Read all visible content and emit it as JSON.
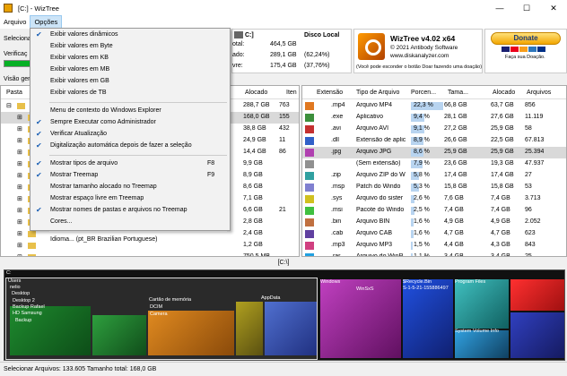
{
  "window": {
    "title": "[C:] - WizTree",
    "minimize": "—",
    "maximize": "☐",
    "close": "✕"
  },
  "menubar": {
    "items": [
      "Arquivo",
      "Opções"
    ]
  },
  "toppanel": {
    "select_label": "Seleciona",
    "verify_label": "Verificaç",
    "view_label": "Visão ger",
    "drive": "C:]",
    "drive_name": "Disco Local",
    "total_label": "otal:",
    "total_value": "464,5 GB",
    "used_label": "ado:",
    "used_value": "289,1 GB",
    "used_pct": "(62,24%)",
    "free_label": "vre:",
    "free_value": "175,4 GB",
    "free_pct": "(37,76%)"
  },
  "logo": {
    "title": "WizTree v4.02 x64",
    "copyright": "© 2021 Antibody Software",
    "url": "www.diskanalyzer.com",
    "note": "(Você pode esconder o botão Doar fazendo uma doação)"
  },
  "donate": {
    "button": "Donate",
    "thanks": "Faça sua Doação.",
    "cards_colors": [
      "#1a1f71",
      "#eb001b",
      "#f79e1b",
      "#2e77bc",
      "#003087"
    ]
  },
  "left": {
    "headers": [
      "Pasta",
      "Alocado",
      "Iten"
    ],
    "rows": [
      {
        "alloc": "288,7 GB",
        "items": "763"
      },
      {
        "alloc": "168,0 GB",
        "items": "155"
      },
      {
        "alloc": "38,8 GB",
        "items": "432"
      },
      {
        "alloc": "24,9 GB",
        "items": "11"
      },
      {
        "alloc": "14,4 GB",
        "items": "86"
      },
      {
        "alloc": "9,9 GB",
        "items": ""
      },
      {
        "alloc": "8,9 GB",
        "items": ""
      },
      {
        "alloc": "8,6 GB",
        "items": ""
      },
      {
        "alloc": "7,1 GB",
        "items": ""
      },
      {
        "alloc": "6,6 GB",
        "items": "21"
      },
      {
        "alloc": "2,8 GB",
        "items": ""
      },
      {
        "alloc": "2,4 GB",
        "items": ""
      },
      {
        "alloc": "1,2 GB",
        "items": ""
      },
      {
        "alloc": "750,5 MB",
        "items": ""
      }
    ]
  },
  "right": {
    "headers": [
      "Extensão",
      "Tipo de Arquivo",
      "Porcen...",
      "Tama...",
      "Alocado",
      "Arquivos"
    ],
    "rows": [
      {
        "ext": ".mp4",
        "type": "Arquivo MP4",
        "pct": "22,3 %",
        "size": "66,8 GB",
        "alloc": "63,7 GB",
        "files": "856",
        "color": "#e07820",
        "bar": 0.223
      },
      {
        "ext": ".exe",
        "type": "Aplicativo",
        "pct": "9,4 %",
        "size": "28,1 GB",
        "alloc": "27,6 GB",
        "files": "11.119",
        "color": "#3c8f3c",
        "bar": 0.094
      },
      {
        "ext": ".avi",
        "type": "Arquivo AVI",
        "pct": "9,1 %",
        "size": "27,2 GB",
        "alloc": "25,9 GB",
        "files": "58",
        "color": "#c43030",
        "bar": 0.091
      },
      {
        "ext": ".dll",
        "type": "Extensão de aplic",
        "pct": "8,9 %",
        "size": "26,6 GB",
        "alloc": "22,5 GB",
        "files": "67.813",
        "color": "#3060c8",
        "bar": 0.089
      },
      {
        "ext": ".jpg",
        "type": "Arquivo JPG",
        "pct": "8,6 %",
        "size": "25,9 GB",
        "alloc": "25,9 GB",
        "files": "25.394",
        "color": "#b040b0",
        "bar": 0.086
      },
      {
        "ext": "",
        "type": "(Sem extensão)",
        "pct": "7,9 %",
        "size": "23,6 GB",
        "alloc": "19,3 GB",
        "files": "47.937",
        "color": "#909090",
        "bar": 0.079
      },
      {
        "ext": ".zip",
        "type": "Arquivo ZIP do W",
        "pct": "5,8 %",
        "size": "17,4 GB",
        "alloc": "17,4 GB",
        "files": "27",
        "color": "#30a0a0",
        "bar": 0.058
      },
      {
        "ext": ".msp",
        "type": "Patch do Windo",
        "pct": "5,3 %",
        "size": "15,8 GB",
        "alloc": "15,8 GB",
        "files": "53",
        "color": "#8080d0",
        "bar": 0.053
      },
      {
        "ext": ".sys",
        "type": "Arquivo do sister",
        "pct": "2,6 %",
        "size": "7,6 GB",
        "alloc": "7,4 GB",
        "files": "3.713",
        "color": "#d0c020",
        "bar": 0.026
      },
      {
        "ext": ".msi",
        "type": "Pacote do Windo",
        "pct": "2,5 %",
        "size": "7,4 GB",
        "alloc": "7,4 GB",
        "files": "96",
        "color": "#40c040",
        "bar": 0.025
      },
      {
        "ext": ".bin",
        "type": "Arquivo BIN",
        "pct": "1,6 %",
        "size": "4,9 GB",
        "alloc": "4,9 GB",
        "files": "2.052",
        "color": "#c07040",
        "bar": 0.016
      },
      {
        "ext": ".cab",
        "type": "Arquivo CAB",
        "pct": "1,6 %",
        "size": "4,7 GB",
        "alloc": "4,7 GB",
        "files": "623",
        "color": "#6040a0",
        "bar": 0.016
      },
      {
        "ext": ".mp3",
        "type": "Arquivo MP3",
        "pct": "1,5 %",
        "size": "4,4 GB",
        "alloc": "4,3 GB",
        "files": "843",
        "color": "#d04080",
        "bar": 0.015
      },
      {
        "ext": ".rar",
        "type": "Arquivo do WinR",
        "pct": "1,1 %",
        "size": "3,4 GB",
        "alloc": "3,4 GB",
        "files": "25",
        "color": "#20a0e0",
        "bar": 0.011
      }
    ]
  },
  "path": "[C:\\]",
  "treemap": {
    "labels": {
      "c": "C:",
      "users": "Users",
      "user": "nelio",
      "desktop": "Desktop",
      "desktop2": "Desktop 2",
      "backup_rafael": "Backup Rafael",
      "hd_samsung": "HD Samsung",
      "backup": "Backup",
      "cartao": "Cartão de memória",
      "dcim": "DCIM",
      "camera": "Camera",
      "appdata": "AppData",
      "windows": "Windows",
      "winsxs": "WinSxS",
      "recycle": "$Recycle.Bin",
      "sid": "S-1-5-21-155886497",
      "program_files": "Program Files",
      "system_volume": "System Volume Info"
    }
  },
  "status": "Selecionar Arquivos: 133.605  Tamanho total: 168,0 GB",
  "menu": {
    "items": [
      {
        "label": "Exibir valores dinâmicos",
        "checked": true,
        "shortcut": ""
      },
      {
        "label": "Exibir valores em Byte",
        "checked": false,
        "shortcut": ""
      },
      {
        "label": "Exibir valores em KB",
        "checked": false,
        "shortcut": ""
      },
      {
        "label": "Exibir valores em MB",
        "checked": false,
        "shortcut": ""
      },
      {
        "label": "Exibir valores em GB",
        "checked": false,
        "shortcut": ""
      },
      {
        "label": "Exibir valores de TB",
        "checked": false,
        "shortcut": ""
      },
      {
        "sep": true
      },
      {
        "label": "Menu de contexto do Windows Explorer",
        "checked": false,
        "shortcut": ""
      },
      {
        "label": "Sempre Executar como Administrador",
        "checked": true,
        "shortcut": ""
      },
      {
        "label": "Verificar Atualização",
        "checked": true,
        "shortcut": ""
      },
      {
        "label": "Digitalização automática depois de fazer a seleção",
        "checked": true,
        "shortcut": ""
      },
      {
        "sep": true
      },
      {
        "label": "Mostrar tipos de arquivo",
        "checked": true,
        "shortcut": "F8"
      },
      {
        "label": "Mostrar Treemap",
        "checked": true,
        "shortcut": "F9"
      },
      {
        "label": "Mostrar tamanho alocado no Treemap",
        "checked": false,
        "shortcut": ""
      },
      {
        "label": "Mostrar espaço livre em Treemap",
        "checked": false,
        "shortcut": ""
      },
      {
        "label": "Mostrar nomes de pastas e arquivos no Treemap",
        "checked": true,
        "shortcut": ""
      },
      {
        "label": "Cores...",
        "checked": false,
        "shortcut": ""
      },
      {
        "sep": true
      },
      {
        "label": "Idioma... (pt_BR Brazilian Portuguese)",
        "checked": false,
        "shortcut": ""
      }
    ]
  }
}
